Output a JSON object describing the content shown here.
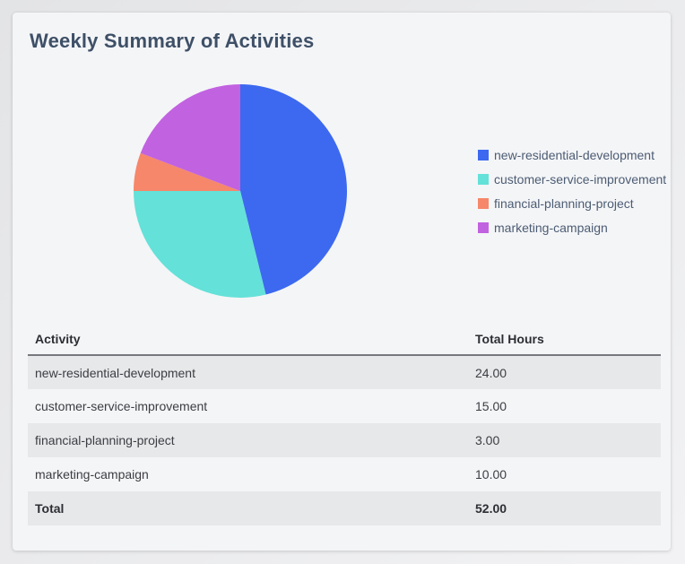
{
  "card": {
    "title": "Weekly Summary of Activities"
  },
  "chart_data": {
    "type": "pie",
    "title": "Weekly Summary of Activities",
    "categories": [
      "new-residential-development",
      "customer-service-improvement",
      "financial-planning-project",
      "marketing-campaign"
    ],
    "values": [
      24,
      15,
      3,
      10
    ],
    "total": 52,
    "unit": "hours",
    "colors": [
      "#3c69f0",
      "#64e1d8",
      "#f6876a",
      "#c162e0"
    ],
    "legend_position": "right",
    "start_angle_deg": -90,
    "direction": "clockwise"
  },
  "table": {
    "columns": [
      "Activity",
      "Total Hours"
    ],
    "rows": [
      {
        "activity": "new-residential-development",
        "total_hours": "24.00"
      },
      {
        "activity": "customer-service-improvement",
        "total_hours": "15.00"
      },
      {
        "activity": "financial-planning-project",
        "total_hours": "3.00"
      },
      {
        "activity": "marketing-campaign",
        "total_hours": "10.00"
      }
    ],
    "total_row": {
      "activity": "Total",
      "total_hours": "52.00"
    }
  },
  "theme": {
    "page_bg_start": "#e3e4e6",
    "page_bg_end": "#f2f2f4",
    "card_bg": "#f4f5f7",
    "title_color": "#3e5067",
    "legend_text_color": "#4c5c73",
    "stripe_bg": "#e7e8ea",
    "header_border_color": "#77787d",
    "header_text_color": "#2d2e33",
    "row_text_color": "#3c3d42"
  }
}
